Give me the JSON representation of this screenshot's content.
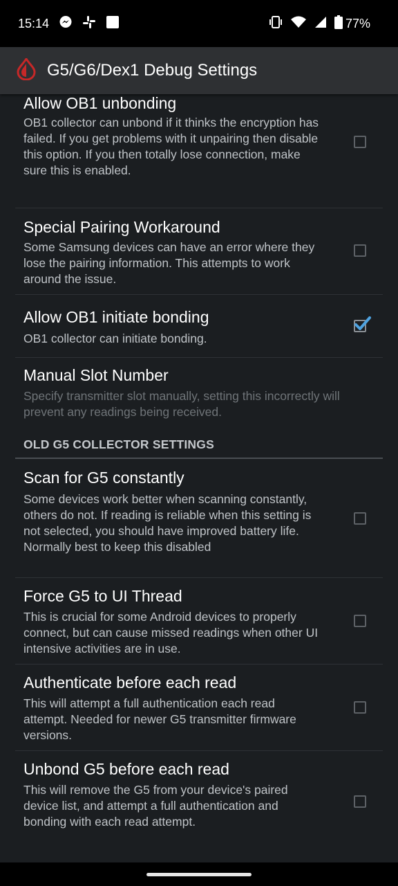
{
  "status_bar": {
    "time": "15:14",
    "battery": "77%"
  },
  "app_bar": {
    "title": "G5/G6/Dex1 Debug Settings"
  },
  "preferences": [
    {
      "title": "Allow OB1 unbonding",
      "summary": "OB1 collector can unbond if it thinks the encryption has failed. If you get problems with it unpairing then disable this option. If you then totally lose connection, make sure this is enabled.",
      "checked": false
    },
    {
      "title": "Special Pairing Workaround",
      "summary": "Some Samsung devices can have an error where they lose the pairing information. This attempts to work around the issue.",
      "checked": false
    },
    {
      "title": "Allow OB1 initiate bonding",
      "summary": "OB1 collector can initiate bonding.",
      "checked": true
    },
    {
      "title": "Manual Slot Number",
      "summary": "Specify transmitter slot manually, setting this incorrectly will prevent any readings being received.",
      "enabled": false
    }
  ],
  "category": {
    "title": "OLD G5 COLLECTOR SETTINGS"
  },
  "old_preferences": [
    {
      "title": "Scan for G5 constantly",
      "summary": "Some devices work better when scanning constantly, others do not. If reading is reliable when this setting is not selected, you should have improved battery life. Normally best to keep this disabled",
      "checked": false
    },
    {
      "title": "Force G5 to UI Thread",
      "summary": "This is crucial for some Android devices to properly connect, but can cause missed readings when other UI intensive activities are in use.",
      "checked": false
    },
    {
      "title": "Authenticate before each read",
      "summary": "This will attempt a full authentication each read attempt. Needed for newer G5 transmitter firmware versions.",
      "checked": false
    },
    {
      "title": "Unbond G5 before each read",
      "summary": "This will remove the G5 from your device's paired device list, and attempt a full authentication and bonding with each read attempt.",
      "checked": false
    }
  ],
  "colors": {
    "accent": "#4fa3e0",
    "app_icon": "#c62828",
    "background": "#1b1e21",
    "app_bar": "#2e3033"
  }
}
